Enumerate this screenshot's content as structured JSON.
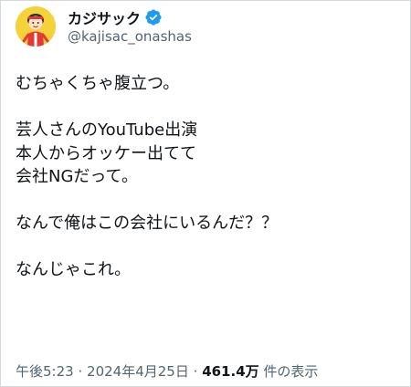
{
  "author": {
    "display_name": "カジサック",
    "handle": "@kajisac_onashas",
    "verified_icon": "verified-badge-icon",
    "avatar_icon": "avatar-kajisac"
  },
  "post": {
    "lines": [
      "むちゃくちゃ腹立つ。",
      "",
      "芸人さんのYouTube出演",
      "本人からオッケー出てて",
      "会社NGだって。",
      "",
      "なんで俺はこの会社にいるんだ？？",
      "",
      "なんじゃこれ。"
    ]
  },
  "meta": {
    "time": "午後5:23",
    "separator": "·",
    "date": "2024年4月25日",
    "views_count": "461.4万",
    "views_label": "件の表示"
  },
  "colors": {
    "accent": "#1d9bf0",
    "text": "#0f1419",
    "muted": "#536471",
    "border": "#cfd9de",
    "avatar_bg": "#f6d23a"
  }
}
